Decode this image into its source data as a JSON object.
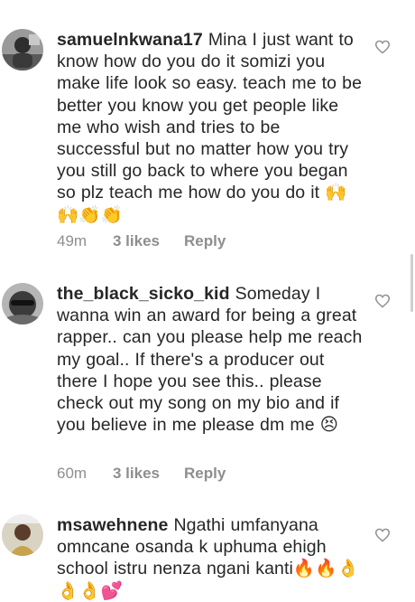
{
  "comments": [
    {
      "username": "samuelnkwana17",
      "text": "Mina I just want to know how do you do it somizi you make life look so easy. teach me to be better you know you get people like me who wish and tries to be successful but no matter how you try you still go back to where you began so plz teach me how do you do it 🙌🙌👏👏",
      "time": "49m",
      "likes": "3 likes",
      "reply": "Reply",
      "avatar_icon": "profile-photo",
      "like_icon": "heart-outline-icon"
    },
    {
      "username": "the_black_sicko_kid",
      "text": "Someday I wanna win an award for being a great rapper.. can you please help me reach my goal.. If there's a producer out there I hope you see this.. please check out my song on my bio and if you believe in me please dm me 😣",
      "time": "60m",
      "likes": "3 likes",
      "reply": "Reply",
      "avatar_icon": "profile-photo",
      "like_icon": "heart-outline-icon"
    },
    {
      "username": "msawehnene",
      "text": "Ngathi umfanyana omncane osanda k uphuma ehigh school istru nenza ngani kanti🔥🔥👌👌👌💕",
      "avatar_icon": "profile-photo",
      "like_icon": "heart-outline-icon"
    }
  ],
  "colors": {
    "text": "#262626",
    "meta": "#8e8e8e",
    "background": "#ffffff"
  }
}
